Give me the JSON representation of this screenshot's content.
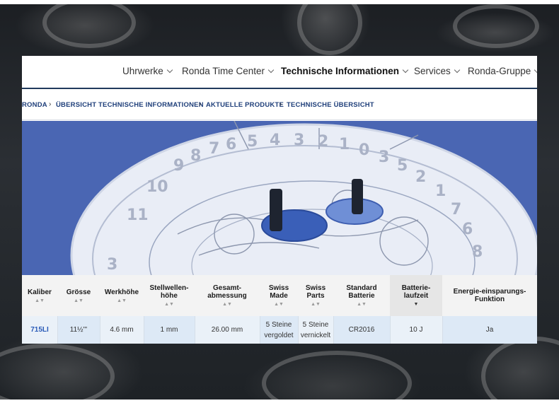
{
  "nav": {
    "items": [
      {
        "label": "Uhrwerke",
        "active": false
      },
      {
        "label": "Ronda Time Center",
        "active": false
      },
      {
        "label": "Technische Informationen",
        "active": true
      },
      {
        "label": "Services",
        "active": false
      },
      {
        "label": "Ronda-Gruppe",
        "active": false
      }
    ]
  },
  "breadcrumb": {
    "items": [
      "RONDA",
      "ÜBERSICHT TECHNISCHE INFORMATIONEN",
      "AKTUELLE PRODUKTE",
      "TECHNISCHE ÜBERSICHT"
    ],
    "separator": "›"
  },
  "hero": {
    "description_icon": "watch-movement-xray-image",
    "dial_numbers": [
      "3",
      "11",
      "10",
      "9",
      "8",
      "7",
      "6",
      "5",
      "4",
      "3",
      "2",
      "1",
      "0",
      "3",
      "5",
      "2",
      "1",
      "7",
      "6",
      "8"
    ]
  },
  "table": {
    "headers": [
      {
        "line1": "Kaliber",
        "line2": ""
      },
      {
        "line1": "Grösse",
        "line2": ""
      },
      {
        "line1": "Werkhöhe",
        "line2": ""
      },
      {
        "line1": "Stellwellen-",
        "line2": "höhe"
      },
      {
        "line1": "Gesamt-",
        "line2": "abmessung"
      },
      {
        "line1": "Swiss",
        "line2": "Made"
      },
      {
        "line1": "Swiss",
        "line2": "Parts"
      },
      {
        "line1": "Standard",
        "line2": "Batterie"
      },
      {
        "line1": "Batterie-",
        "line2": "laufzeit"
      },
      {
        "line1": "Energie-einsparungs-",
        "line2": "Funktion"
      }
    ],
    "row": {
      "kaliber": "715LI",
      "groesse": "11½'''",
      "werkhoehe": "4.6 mm",
      "stellwellenhoehe": "1 mm",
      "gesamtabmessung": "26.00 mm",
      "swiss_made_1": "5 Steine",
      "swiss_made_2": "vergoldet",
      "swiss_parts_1": "5 Steine",
      "swiss_parts_2": "vernickelt",
      "batterie": "CR2016",
      "laufzeit": "10 J",
      "energie": "Ja"
    },
    "sort_icons": {
      "default": "▲▼",
      "active": "▼"
    },
    "colors": {
      "link": "#2a5bb8",
      "row_bg": "#eaf1f8",
      "header_bg": "#f3f3f3"
    }
  },
  "colors": {
    "nav_border": "#203a5c",
    "crumb_text": "#1f3f7a",
    "hero_bg": "#4a66b3"
  }
}
